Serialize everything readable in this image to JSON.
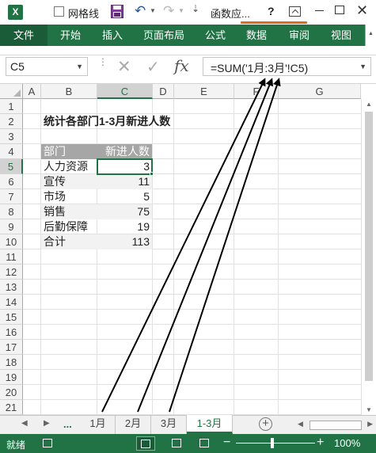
{
  "titlebar": {
    "app_logo": "X",
    "gridlines_label": "网格线",
    "gridlines_checked": false,
    "doc_title": "函数应...",
    "help": "?",
    "icons": [
      "excel-logo",
      "save-icon",
      "undo-icon",
      "redo-icon",
      "ribbon-display-icon",
      "minimize-icon",
      "maximize-icon",
      "close-icon"
    ]
  },
  "ribbon": {
    "tabs": [
      "文件",
      "开始",
      "插入",
      "页面布局",
      "公式",
      "数据",
      "审阅",
      "视图"
    ]
  },
  "formula_bar": {
    "name_box": "C5",
    "formula": "=SUM('1月:3月'!C5)",
    "formula_prefix": "=SUM(",
    "formula_ref": "'1月:3月'",
    "formula_suffix": "!C5)",
    "underline_color": "#e06c1b"
  },
  "grid": {
    "columns": [
      "A",
      "B",
      "C",
      "D",
      "E",
      "F",
      "G"
    ],
    "selected_column": "C",
    "rows": [
      "1",
      "2",
      "3",
      "4",
      "5",
      "6",
      "7",
      "8",
      "9",
      "10",
      "11",
      "12",
      "13",
      "14",
      "15",
      "16",
      "17",
      "18",
      "19",
      "20",
      "21"
    ],
    "selected_row": "5",
    "title": "统计各部门1-3月新进人数",
    "table": {
      "headers": [
        "部门",
        "新进人数"
      ],
      "rows": [
        {
          "dept": "人力资源",
          "count": "3"
        },
        {
          "dept": "宣传",
          "count": "11"
        },
        {
          "dept": "市场",
          "count": "5"
        },
        {
          "dept": "销售",
          "count": "75"
        },
        {
          "dept": "后勤保障",
          "count": "19"
        },
        {
          "dept": "合计",
          "count": "113"
        }
      ],
      "header_color": "#a6a6a6",
      "alt_row_color": "#f2f2f2"
    }
  },
  "sheet_tabs": {
    "more": "...",
    "tabs": [
      "1月",
      "2月",
      "3月",
      "1-3月"
    ],
    "active": "1-3月",
    "add_label": "+"
  },
  "status_bar": {
    "status": "就绪",
    "zoom": "100%",
    "zoom_minus": "−",
    "zoom_plus": "+"
  },
  "colors": {
    "accent": "#217346",
    "arrow": "#000000"
  }
}
